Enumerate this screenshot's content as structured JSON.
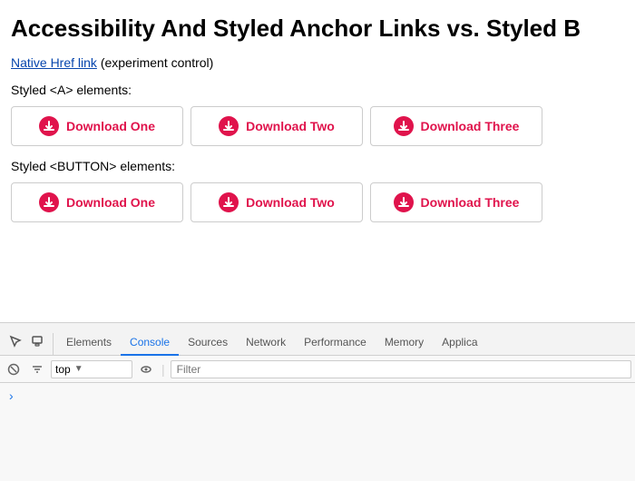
{
  "page": {
    "title": "Accessibility And Styled Anchor Links vs. Styled B",
    "native_link_text": "Native Href link",
    "experiment_note": "(experiment control)",
    "anchor_section_label": "Styled <A> elements:",
    "button_section_label": "Styled <BUTTON> elements:",
    "download_buttons": [
      {
        "label": "Download One"
      },
      {
        "label": "Download Two"
      },
      {
        "label": "Download Three"
      }
    ]
  },
  "devtools": {
    "tabs": [
      {
        "label": "Elements",
        "active": false
      },
      {
        "label": "Console",
        "active": true
      },
      {
        "label": "Sources",
        "active": false
      },
      {
        "label": "Network",
        "active": false
      },
      {
        "label": "Performance",
        "active": false
      },
      {
        "label": "Memory",
        "active": false
      },
      {
        "label": "Applica",
        "active": false
      }
    ],
    "toolbar": {
      "context_label": "top",
      "filter_placeholder": "Filter"
    }
  },
  "icons": {
    "download": "⬇",
    "caret_symbol": "›"
  }
}
